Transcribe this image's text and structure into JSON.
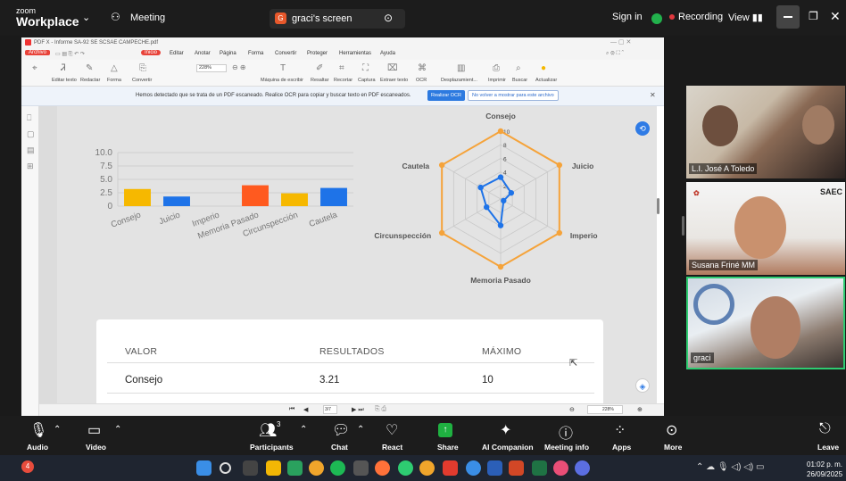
{
  "zoom": {
    "logo_top": "zoom",
    "logo_bottom": "Workplace",
    "meeting_label": "Meeting",
    "screen_label": "graci's screen",
    "sign_in": "Sign in",
    "recording": "Recording",
    "view": "View",
    "controls": {
      "audio": "Audio",
      "video": "Video",
      "participants": "Participants",
      "participants_count": "3",
      "chat": "Chat",
      "react": "React",
      "share": "Share",
      "ai_companion": "AI Companion",
      "meeting_info": "Meeting info",
      "apps": "Apps",
      "more": "More",
      "leave": "Leave"
    },
    "participants": [
      {
        "name": "L.I. José A Toledo"
      },
      {
        "name": "Susana Friné MM"
      },
      {
        "name": "graci"
      }
    ]
  },
  "pdf": {
    "title": "PDF X - Informe SA-92 SE SCSAE CAMPECHE.pdf",
    "menu": [
      "Archivo",
      "Inicio",
      "Editar",
      "Anotar",
      "Página",
      "Forma",
      "Convertir",
      "Proteger",
      "Herramientas",
      "Ayuda"
    ],
    "toolbar_labels": [
      "Editar texto",
      "Redactar",
      "Forma",
      "Convertir",
      "Máquina de escribir",
      "Resaltar",
      "Recortar",
      "Captura",
      "Extraer texto",
      "OCR",
      "Desplazamient...",
      "Imprimir",
      "Buscar",
      "Actualizar"
    ],
    "zoom_value": "228%",
    "ocr_message": "Hemos detectado que se trata de un PDF escaneado. Realice OCR para copiar y buscar texto en PDF escaneados.",
    "ocr_button": "Realizar OCR",
    "ocr_dismiss": "No volver a mostrar para este archivo",
    "page_indicator": "3/7",
    "bottom_zoom": "228%"
  },
  "chart_data": [
    {
      "type": "bar",
      "categories": [
        "Consejo",
        "Juicio",
        "Imperio",
        "Memoria Pasado",
        "Circunspección",
        "Cautela"
      ],
      "values": [
        3.2,
        1.8,
        0,
        3.9,
        2.4,
        3.4
      ],
      "colors": [
        "#f6b800",
        "#1e73e8",
        "#cccccc",
        "#ff5a1f",
        "#f6b800",
        "#1e73e8"
      ],
      "yticks": [
        "10.0",
        "7.5",
        "5.0",
        "2.5",
        "0"
      ],
      "ylim": [
        0,
        10
      ]
    },
    {
      "type": "radar",
      "axes": [
        "Consejo",
        "Juicio",
        "Imperio",
        "Memoria Pasado",
        "Circunspección",
        "Cautela"
      ],
      "series": [
        {
          "values": [
            3.21,
            1.8,
            0.5,
            3.9,
            2.4,
            3.4
          ],
          "color": "#1e73e8"
        },
        {
          "values": [
            10,
            10,
            10,
            10,
            10,
            10
          ],
          "color": "#f5a33a"
        }
      ],
      "rticks": [
        "2",
        "4",
        "6",
        "8",
        "10"
      ],
      "rmax": 10
    }
  ],
  "table": {
    "headers": [
      "VALOR",
      "RESULTADOS",
      "MÁXIMO"
    ],
    "rows": [
      [
        "Consejo",
        "3.21",
        "10"
      ]
    ]
  },
  "system": {
    "time": "01:02 p. m.",
    "date": "26/09/2025",
    "notification_count": "4"
  }
}
